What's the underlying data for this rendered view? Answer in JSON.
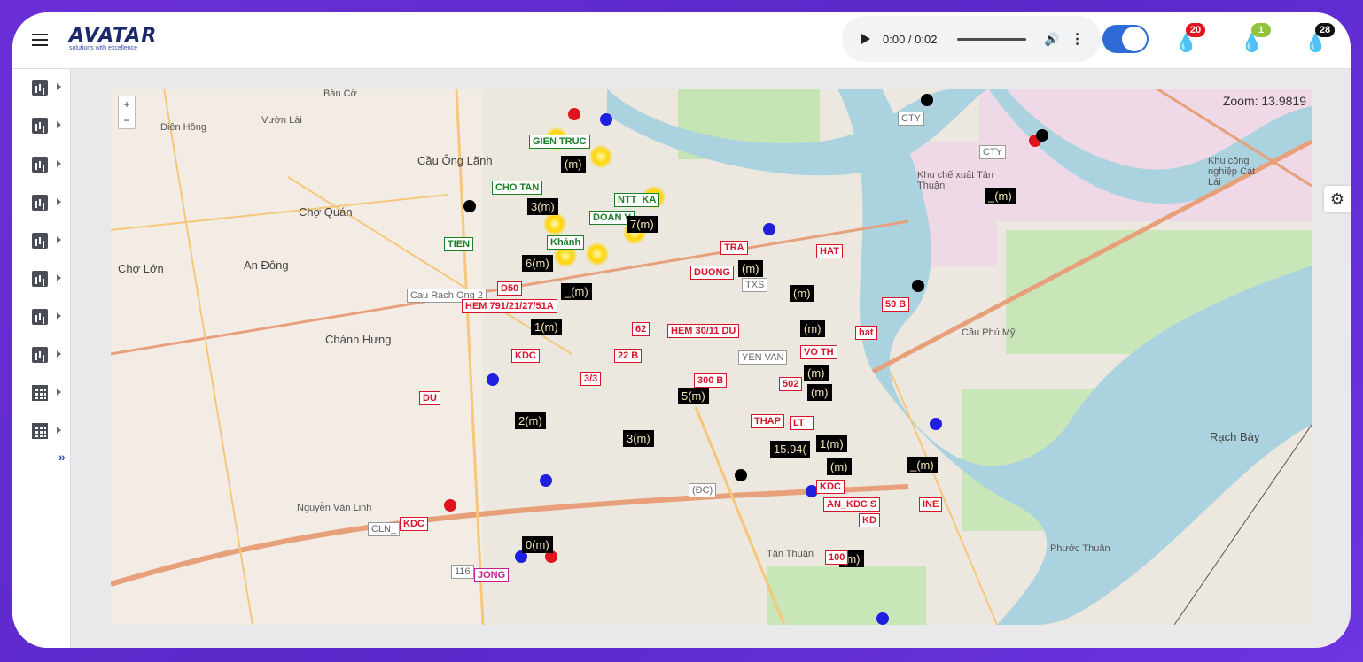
{
  "header": {
    "brand": "AVATAR",
    "tagline": "solutions with excellence",
    "audio": {
      "time": "0:00 / 0:02"
    },
    "badges": [
      {
        "value": "20",
        "color": "#e0141e",
        "icon": "drop-red-icon"
      },
      {
        "value": "1",
        "color": "#8fc43b",
        "icon": "drop-green-icon"
      },
      {
        "value": "28",
        "color": "#111111",
        "icon": "drop-black-icon"
      }
    ]
  },
  "sidebar": {
    "items": [
      "chart-icon",
      "chart-icon",
      "chart-icon",
      "chart-icon",
      "chart-icon",
      "chart-icon",
      "chart-icon",
      "chart-icon",
      "grid-icon",
      "grid-icon"
    ]
  },
  "map": {
    "zoom_in": "+",
    "zoom_out": "−",
    "zoom_label": "Zoom: 13.9819",
    "places": {
      "ben_co": "Bàn Cờ",
      "vuon_lai": "Vườn Lài",
      "dien_hong": "Diên Hồng",
      "cau_ong_lanh": "Cầu Ông Lãnh",
      "cho_quan": "Chợ Quán",
      "an_dong": "An Đông",
      "cho_lon": "Chợ Lớn",
      "chanh_hung": "Chánh Hưng",
      "khu_xuat_tan_thuan": "Khu chế xuất Tân Thuận",
      "khu_cong_nghiep_cat_lai": "Khu công nghiệp Cát Lái",
      "rach_bay": "Rạch Bày",
      "tan_thuan": "Tân Thuận",
      "phuoc_thuan": "Phước Thuận",
      "nguyen_van_linh": "Nguyễn Văn Linh",
      "cau_phu_my": "Cầu Phú Mỹ"
    },
    "labels": {
      "l1": "GIEN TRUC",
      "l2": "CHO TAN",
      "l3": "NTT_KA",
      "l4": "DOAN V",
      "l5": "Khánh",
      "l6": "TRA",
      "l7": "HAT",
      "l8": "Cau Rach Ong 2",
      "l9": "D50",
      "l10": "HEM 791/21/27/51A",
      "l11": "DUONG",
      "l12": "TXS",
      "l13": "59 B",
      "l14": "HEM 30/11 DU",
      "l15": "hat",
      "l16": "KDC",
      "l17": "VO TH",
      "l18": "22 B",
      "l19": "3/3",
      "l20": "300 B",
      "l21": "502",
      "l22": "DU",
      "l23": "THAP",
      "l24": "LT_",
      "l25": "(ĐC)",
      "l26": "KD",
      "l27": "AN_KDC S",
      "l28": "INE",
      "l29": "CLN_",
      "l30": "116",
      "l31": "JONG",
      "l32": "TIEN",
      "l33": "CTY",
      "l34": "YEN VAN",
      "l35": "100",
      "l36": "KDC",
      "l37": "62"
    },
    "readings": {
      "r1": "(m)",
      "r2": "3(m)",
      "r3": "7(m)",
      "r4": "6(m)",
      "r5": "(m)",
      "r6": "_(m)",
      "r7": "1(m)",
      "r8": "(m)",
      "r9": "(m)",
      "r10": "5(m)",
      "r11": "2(m)",
      "r12": "3(m)",
      "r13": "15.94(",
      "r14": "1(m)",
      "r15": "(m)",
      "r16": "0(m)",
      "r17": "(m)",
      "r18": "(m)",
      "r19": "(m)",
      "r20": "_(m)"
    }
  }
}
